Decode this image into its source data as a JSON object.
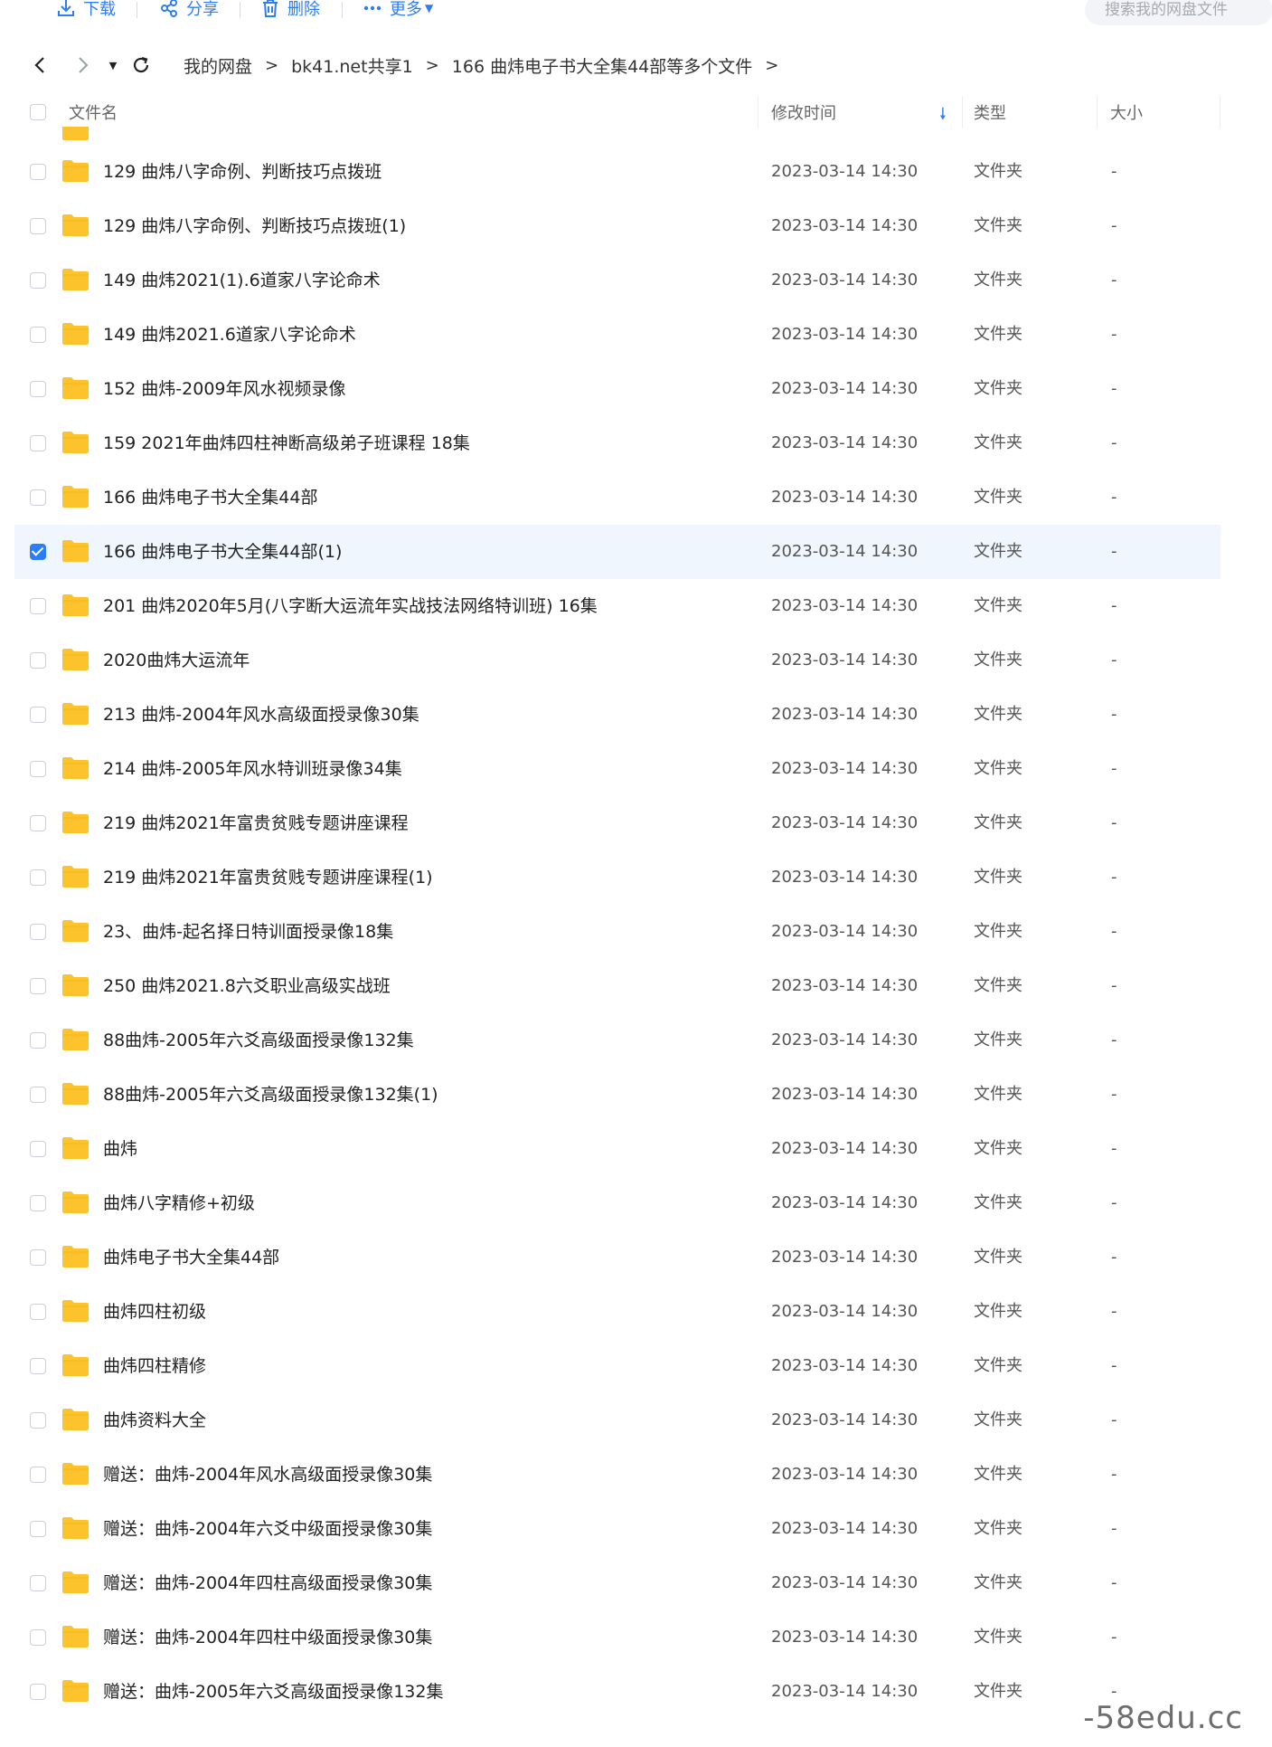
{
  "toolbar": {
    "download": "下载",
    "share": "分享",
    "delete": "删除",
    "more": "更多",
    "search_placeholder": "搜索我的网盘文件"
  },
  "breadcrumb": [
    "我的网盘",
    "bk41.net共享1",
    "166 曲炜电子书大全集44部等多个文件"
  ],
  "columns": {
    "name": "文件名",
    "modified": "修改时间",
    "type": "类型",
    "size": "大小"
  },
  "colors": {
    "accent": "#2d7df6",
    "folder": "#fcc32c",
    "selected_row": "#eff6fe"
  },
  "files": [
    {
      "name": "129 曲炜八字命例、判断技巧点拨班",
      "date": "2023-03-14 14:30",
      "type": "文件夹",
      "size": "-",
      "selected": false
    },
    {
      "name": "129 曲炜八字命例、判断技巧点拨班(1)",
      "date": "2023-03-14 14:30",
      "type": "文件夹",
      "size": "-",
      "selected": false
    },
    {
      "name": "149 曲炜2021(1).6道家八字论命术",
      "date": "2023-03-14 14:30",
      "type": "文件夹",
      "size": "-",
      "selected": false
    },
    {
      "name": "149 曲炜2021.6道家八字论命术",
      "date": "2023-03-14 14:30",
      "type": "文件夹",
      "size": "-",
      "selected": false
    },
    {
      "name": "152 曲炜-2009年风水视频录像",
      "date": "2023-03-14 14:30",
      "type": "文件夹",
      "size": "-",
      "selected": false
    },
    {
      "name": "159  2021年曲炜四柱神断高级弟子班课程 18集",
      "date": "2023-03-14 14:30",
      "type": "文件夹",
      "size": "-",
      "selected": false
    },
    {
      "name": "166 曲炜电子书大全集44部",
      "date": "2023-03-14 14:30",
      "type": "文件夹",
      "size": "-",
      "selected": false
    },
    {
      "name": "166 曲炜电子书大全集44部(1)",
      "date": "2023-03-14 14:30",
      "type": "文件夹",
      "size": "-",
      "selected": true
    },
    {
      "name": "201 曲炜2020年5月(八字断大运流年实战技法网络特训班) 16集",
      "date": "2023-03-14 14:30",
      "type": "文件夹",
      "size": "-",
      "selected": false
    },
    {
      "name": "2020曲炜大运流年",
      "date": "2023-03-14 14:30",
      "type": "文件夹",
      "size": "-",
      "selected": false
    },
    {
      "name": "213 曲炜-2004年风水高级面授录像30集",
      "date": "2023-03-14 14:30",
      "type": "文件夹",
      "size": "-",
      "selected": false
    },
    {
      "name": "214 曲炜-2005年风水特训班录像34集",
      "date": "2023-03-14 14:30",
      "type": "文件夹",
      "size": "-",
      "selected": false
    },
    {
      "name": "219 曲炜2021年富贵贫贱专题讲座课程",
      "date": "2023-03-14 14:30",
      "type": "文件夹",
      "size": "-",
      "selected": false
    },
    {
      "name": "219 曲炜2021年富贵贫贱专题讲座课程(1)",
      "date": "2023-03-14 14:30",
      "type": "文件夹",
      "size": "-",
      "selected": false
    },
    {
      "name": "23、曲炜-起名择日特训面授录像18集",
      "date": "2023-03-14 14:30",
      "type": "文件夹",
      "size": "-",
      "selected": false
    },
    {
      "name": "250 曲炜2021.8六爻职业高级实战班",
      "date": "2023-03-14 14:30",
      "type": "文件夹",
      "size": "-",
      "selected": false
    },
    {
      "name": "88曲炜-2005年六爻高级面授录像132集",
      "date": "2023-03-14 14:30",
      "type": "文件夹",
      "size": "-",
      "selected": false
    },
    {
      "name": "88曲炜-2005年六爻高级面授录像132集(1)",
      "date": "2023-03-14 14:30",
      "type": "文件夹",
      "size": "-",
      "selected": false
    },
    {
      "name": "曲炜",
      "date": "2023-03-14 14:30",
      "type": "文件夹",
      "size": "-",
      "selected": false
    },
    {
      "name": "曲炜八字精修+初级",
      "date": "2023-03-14 14:30",
      "type": "文件夹",
      "size": "-",
      "selected": false
    },
    {
      "name": "曲炜电子书大全集44部",
      "date": "2023-03-14 14:30",
      "type": "文件夹",
      "size": "-",
      "selected": false
    },
    {
      "name": "曲炜四柱初级",
      "date": "2023-03-14 14:30",
      "type": "文件夹",
      "size": "-",
      "selected": false
    },
    {
      "name": "曲炜四柱精修",
      "date": "2023-03-14 14:30",
      "type": "文件夹",
      "size": "-",
      "selected": false
    },
    {
      "name": "曲炜资料大全",
      "date": "2023-03-14 14:30",
      "type": "文件夹",
      "size": "-",
      "selected": false
    },
    {
      "name": "赠送：曲炜-2004年风水高级面授录像30集",
      "date": "2023-03-14 14:30",
      "type": "文件夹",
      "size": "-",
      "selected": false
    },
    {
      "name": "赠送：曲炜-2004年六爻中级面授录像30集",
      "date": "2023-03-14 14:30",
      "type": "文件夹",
      "size": "-",
      "selected": false
    },
    {
      "name": "赠送：曲炜-2004年四柱高级面授录像30集",
      "date": "2023-03-14 14:30",
      "type": "文件夹",
      "size": "-",
      "selected": false
    },
    {
      "name": "赠送：曲炜-2004年四柱中级面授录像30集",
      "date": "2023-03-14 14:30",
      "type": "文件夹",
      "size": "-",
      "selected": false
    },
    {
      "name": "赠送：曲炜-2005年六爻高级面授录像132集",
      "date": "2023-03-14 14:30",
      "type": "文件夹",
      "size": "-",
      "selected": false
    }
  ],
  "watermark": "-58edu.cc"
}
